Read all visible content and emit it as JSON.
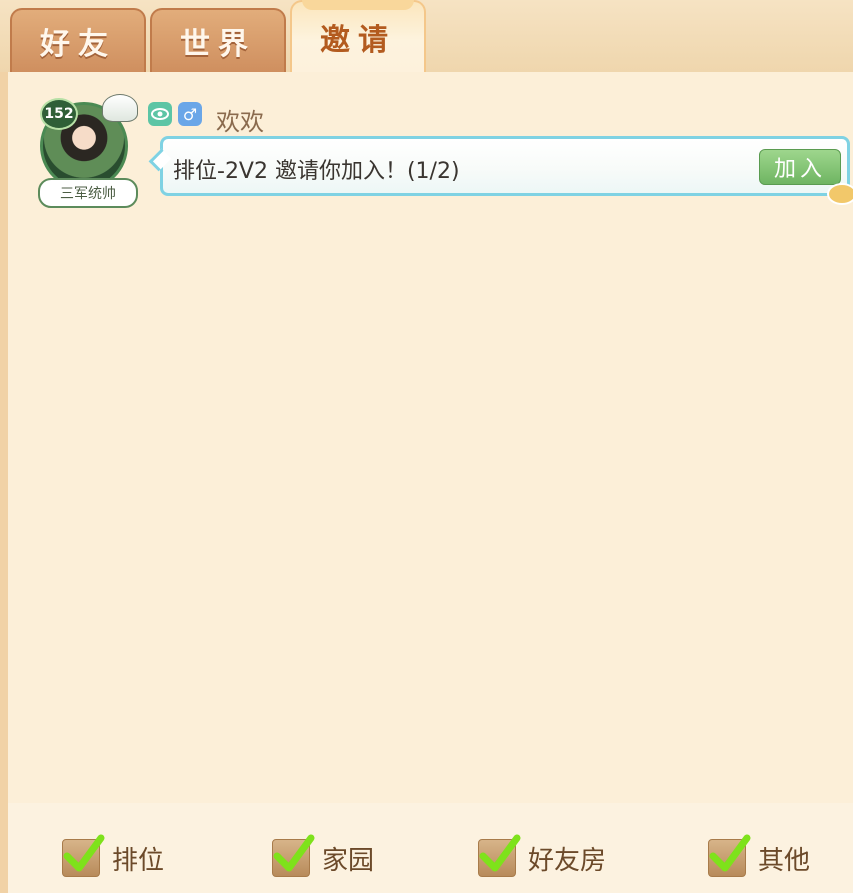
{
  "tabs": [
    {
      "label": "好友",
      "active": false
    },
    {
      "label": "世界",
      "active": false
    },
    {
      "label": "邀请",
      "active": true
    }
  ],
  "message": {
    "avatar": {
      "level": "152",
      "title": "三军统帅"
    },
    "icons": [
      "eye-icon",
      "male-icon"
    ],
    "username": "欢欢",
    "text": "排位-2V2 邀请你加入！(1/2)",
    "join_label": "加入"
  },
  "filters": [
    {
      "label": "排位",
      "checked": true
    },
    {
      "label": "家园",
      "checked": true
    },
    {
      "label": "好友房",
      "checked": true
    },
    {
      "label": "其他",
      "checked": true
    }
  ],
  "colors": {
    "accent_tab_text": "#b35b1f",
    "bubble_border": "#7fd2e3",
    "join_button": "#7cbf6e",
    "check_mark": "#7ee21b"
  }
}
